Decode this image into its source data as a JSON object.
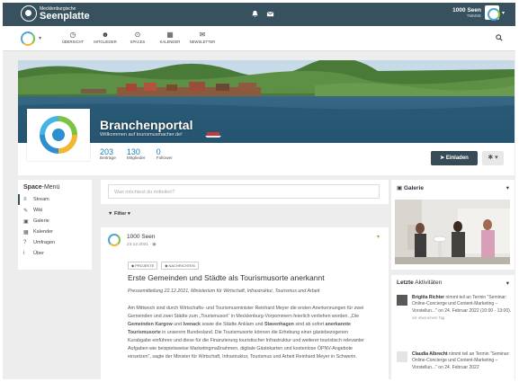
{
  "topbar": {
    "brand_small": "Mecklenburgische",
    "brand_big": "Seenplatte",
    "icons": [
      "bell-icon",
      "envelope-icon"
    ],
    "user_name": "1000 Seen",
    "user_role": "TMMSE"
  },
  "nav": {
    "items": [
      {
        "label": "ÜBERSICHT",
        "icon": "dashboard-icon",
        "glyph": "◷"
      },
      {
        "label": "MITGLIEDER",
        "icon": "members-icon",
        "glyph": "☻"
      },
      {
        "label": "SPACES",
        "icon": "spaces-icon",
        "glyph": "⊙"
      },
      {
        "label": "KALENDER",
        "icon": "calendar-icon",
        "glyph": "▦"
      },
      {
        "label": "NEWSLETTER",
        "icon": "newsletter-icon",
        "glyph": "✉"
      }
    ]
  },
  "space": {
    "title": "Branchenportal",
    "subtitle": "Willkommen auf tourismusmacher.de!",
    "stats": [
      {
        "value": "203",
        "label": "Beiträge"
      },
      {
        "value": "130",
        "label": "Mitglieder"
      },
      {
        "value": "0",
        "label": "Follower"
      }
    ],
    "invite_label": "Einladen"
  },
  "menu": {
    "title_bold": "Space",
    "title_rest": "-Menü",
    "items": [
      {
        "label": "Stream",
        "icon": "stream-icon",
        "glyph": "≡"
      },
      {
        "label": "Wiki",
        "icon": "wiki-icon",
        "glyph": "✎"
      },
      {
        "label": "Galerie",
        "icon": "gallery-icon",
        "glyph": "▣"
      },
      {
        "label": "Kalender",
        "icon": "calendar-icon",
        "glyph": "▦"
      },
      {
        "label": "Umfragen",
        "icon": "poll-icon",
        "glyph": "?"
      },
      {
        "label": "Über",
        "icon": "info-icon",
        "glyph": "i"
      }
    ]
  },
  "composer": {
    "placeholder": "Was möchtest du mitteilen?"
  },
  "filter_label": "Filter",
  "post": {
    "author": "1000 Seen",
    "date": "23.12.2021 · ",
    "tags": [
      "PROJEKTE",
      "NACHRICHTEN"
    ],
    "title": "Erste Gemeinden und Städte als Tourismusorte anerkannt",
    "lead": "Pressemitteilung 22.12.2021, Ministerium für Wirtschaft, Infrastruktur, Tourismus und Arbeit",
    "body": [
      {
        "t": "Am Mittwoch sind durch Wirtschafts- und Tourismusminister Reinhard Meyer die ersten Anerkennungen für zwei Gemeinden und zwei Städte zum „Tourismusort“ in Mecklenburg-Vorpommern feierlich verliehen worden. „Die ",
        "b": false
      },
      {
        "t": "Gemeinden Kargow",
        "b": true
      },
      {
        "t": " und ",
        "b": false
      },
      {
        "t": "Ivenack",
        "b": true
      },
      {
        "t": " sowie die Städte Anklam und ",
        "b": false
      },
      {
        "t": "Stavenhagen",
        "b": true
      },
      {
        "t": " sind ab sofort ",
        "b": false
      },
      {
        "t": "anerkannte Tourismusorte",
        "b": true
      },
      {
        "t": " in unserem Bundesland. Die Tourismusorte können die Erhebung einer gästebezogenen Kurabgabe einführen und diese für die Finanzierung touristischer Infrastruktur und weiterer touristisch relevanter Aufgaben wie beispielsweise Marketingmaßnahmen, digitale Gästekarten und kostenlose ÖPNV-Angebote einsetzen“, sagte der Minister für Wirtschaft, Infrastruktur, Tourismus und Arbeit Reinhard Meyer in Schwerin.",
        "b": false
      }
    ]
  },
  "gallery": {
    "title": "Galerie"
  },
  "activities": {
    "title_bold": "Letzte",
    "title_rest": " Aktivitäten",
    "items": [
      {
        "name": "Brigitta Richter",
        "text": " nimmt teil an Termin \"Seminar: Online-Concierge und Content-Marketing – Vorstellun...\" on 24. Februar 2022 (10:00 - 13:00).",
        "time": "vor etwa einem Tag"
      },
      {
        "name": "Claudia Albrecht",
        "text": " nimmt teil an Termin \"Seminar: Online-Concierge und Content-Marketing – Vorstellun...\" on 24. Februar 2022",
        "time": ""
      }
    ]
  },
  "colors": {
    "topbar": "#37525e",
    "accent": "#1e7fb8",
    "button": "#364b56"
  }
}
